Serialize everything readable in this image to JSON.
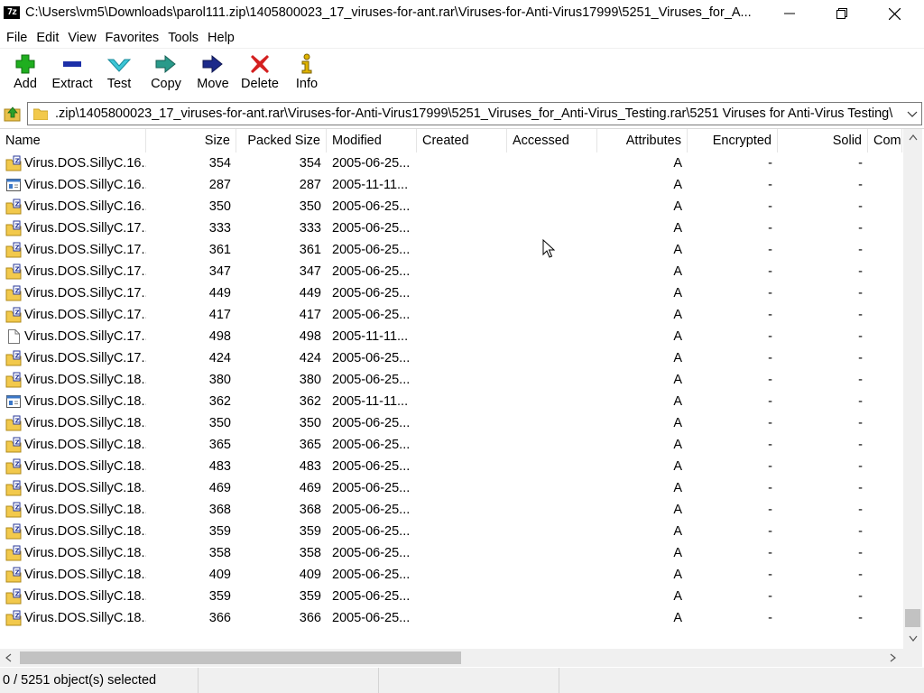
{
  "window": {
    "title": "C:\\Users\\vm5\\Downloads\\parol111.zip\\1405800023_17_viruses-for-ant.rar\\Viruses-for-Anti-Virus17999\\5251_Viruses_for_A...",
    "app_icon_text": "7z"
  },
  "menu": [
    "File",
    "Edit",
    "View",
    "Favorites",
    "Tools",
    "Help"
  ],
  "toolbar": [
    {
      "label": "Add",
      "icon": "plus-icon",
      "color": "#1fae1f"
    },
    {
      "label": "Extract",
      "icon": "minus-icon",
      "color": "#1c2fa8"
    },
    {
      "label": "Test",
      "icon": "check-icon",
      "color": "#2fb6c8"
    },
    {
      "label": "Copy",
      "icon": "copy-arrow-icon",
      "color": "#2a9a8a"
    },
    {
      "label": "Move",
      "icon": "move-arrow-icon",
      "color": "#1c2a8a"
    },
    {
      "label": "Delete",
      "icon": "x-icon",
      "color": "#d42020"
    },
    {
      "label": "Info",
      "icon": "info-icon",
      "color": "#e0b400"
    }
  ],
  "address": {
    "path": ".zip\\1405800023_17_viruses-for-ant.rar\\Viruses-for-Anti-Virus17999\\5251_Viruses_for_Anti-Virus_Testing.rar\\5251 Viruses for Anti-Virus Testing\\"
  },
  "columns": [
    "Name",
    "Size",
    "Packed Size",
    "Modified",
    "Created",
    "Accessed",
    "Attributes",
    "Encrypted",
    "Solid",
    "Com"
  ],
  "rows": [
    {
      "icon": "archive",
      "name": "Virus.DOS.SillyC.16...",
      "size": "354",
      "packed": "354",
      "modified": "2005-06-25...",
      "attributes": "A",
      "encrypted": "-",
      "solid": "-"
    },
    {
      "icon": "exe",
      "name": "Virus.DOS.SillyC.16...",
      "size": "287",
      "packed": "287",
      "modified": "2005-11-11...",
      "attributes": "A",
      "encrypted": "-",
      "solid": "-"
    },
    {
      "icon": "archive",
      "name": "Virus.DOS.SillyC.16...",
      "size": "350",
      "packed": "350",
      "modified": "2005-06-25...",
      "attributes": "A",
      "encrypted": "-",
      "solid": "-"
    },
    {
      "icon": "archive",
      "name": "Virus.DOS.SillyC.17...",
      "size": "333",
      "packed": "333",
      "modified": "2005-06-25...",
      "attributes": "A",
      "encrypted": "-",
      "solid": "-"
    },
    {
      "icon": "archive",
      "name": "Virus.DOS.SillyC.17...",
      "size": "361",
      "packed": "361",
      "modified": "2005-06-25...",
      "attributes": "A",
      "encrypted": "-",
      "solid": "-"
    },
    {
      "icon": "archive",
      "name": "Virus.DOS.SillyC.17...",
      "size": "347",
      "packed": "347",
      "modified": "2005-06-25...",
      "attributes": "A",
      "encrypted": "-",
      "solid": "-"
    },
    {
      "icon": "archive",
      "name": "Virus.DOS.SillyC.17...",
      "size": "449",
      "packed": "449",
      "modified": "2005-06-25...",
      "attributes": "A",
      "encrypted": "-",
      "solid": "-"
    },
    {
      "icon": "archive",
      "name": "Virus.DOS.SillyC.17...",
      "size": "417",
      "packed": "417",
      "modified": "2005-06-25...",
      "attributes": "A",
      "encrypted": "-",
      "solid": "-"
    },
    {
      "icon": "blank",
      "name": "Virus.DOS.SillyC.17...",
      "size": "498",
      "packed": "498",
      "modified": "2005-11-11...",
      "attributes": "A",
      "encrypted": "-",
      "solid": "-"
    },
    {
      "icon": "archive",
      "name": "Virus.DOS.SillyC.17...",
      "size": "424",
      "packed": "424",
      "modified": "2005-06-25...",
      "attributes": "A",
      "encrypted": "-",
      "solid": "-"
    },
    {
      "icon": "archive",
      "name": "Virus.DOS.SillyC.18...",
      "size": "380",
      "packed": "380",
      "modified": "2005-06-25...",
      "attributes": "A",
      "encrypted": "-",
      "solid": "-"
    },
    {
      "icon": "exe",
      "name": "Virus.DOS.SillyC.18...",
      "size": "362",
      "packed": "362",
      "modified": "2005-11-11...",
      "attributes": "A",
      "encrypted": "-",
      "solid": "-"
    },
    {
      "icon": "archive",
      "name": "Virus.DOS.SillyC.18...",
      "size": "350",
      "packed": "350",
      "modified": "2005-06-25...",
      "attributes": "A",
      "encrypted": "-",
      "solid": "-"
    },
    {
      "icon": "archive",
      "name": "Virus.DOS.SillyC.18...",
      "size": "365",
      "packed": "365",
      "modified": "2005-06-25...",
      "attributes": "A",
      "encrypted": "-",
      "solid": "-"
    },
    {
      "icon": "archive",
      "name": "Virus.DOS.SillyC.18...",
      "size": "483",
      "packed": "483",
      "modified": "2005-06-25...",
      "attributes": "A",
      "encrypted": "-",
      "solid": "-"
    },
    {
      "icon": "archive",
      "name": "Virus.DOS.SillyC.18...",
      "size": "469",
      "packed": "469",
      "modified": "2005-06-25...",
      "attributes": "A",
      "encrypted": "-",
      "solid": "-"
    },
    {
      "icon": "archive",
      "name": "Virus.DOS.SillyC.18...",
      "size": "368",
      "packed": "368",
      "modified": "2005-06-25...",
      "attributes": "A",
      "encrypted": "-",
      "solid": "-"
    },
    {
      "icon": "archive",
      "name": "Virus.DOS.SillyC.18...",
      "size": "359",
      "packed": "359",
      "modified": "2005-06-25...",
      "attributes": "A",
      "encrypted": "-",
      "solid": "-"
    },
    {
      "icon": "archive",
      "name": "Virus.DOS.SillyC.18...",
      "size": "358",
      "packed": "358",
      "modified": "2005-06-25...",
      "attributes": "A",
      "encrypted": "-",
      "solid": "-"
    },
    {
      "icon": "archive",
      "name": "Virus.DOS.SillyC.18...",
      "size": "409",
      "packed": "409",
      "modified": "2005-06-25...",
      "attributes": "A",
      "encrypted": "-",
      "solid": "-"
    },
    {
      "icon": "archive",
      "name": "Virus.DOS.SillyC.18...",
      "size": "359",
      "packed": "359",
      "modified": "2005-06-25...",
      "attributes": "A",
      "encrypted": "-",
      "solid": "-"
    },
    {
      "icon": "archive",
      "name": "Virus.DOS.SillyC.18...",
      "size": "366",
      "packed": "366",
      "modified": "2005-06-25...",
      "attributes": "A",
      "encrypted": "-",
      "solid": "-"
    }
  ],
  "status": {
    "selection": "0 / 5251 object(s) selected",
    "section2": "",
    "section3": ""
  }
}
